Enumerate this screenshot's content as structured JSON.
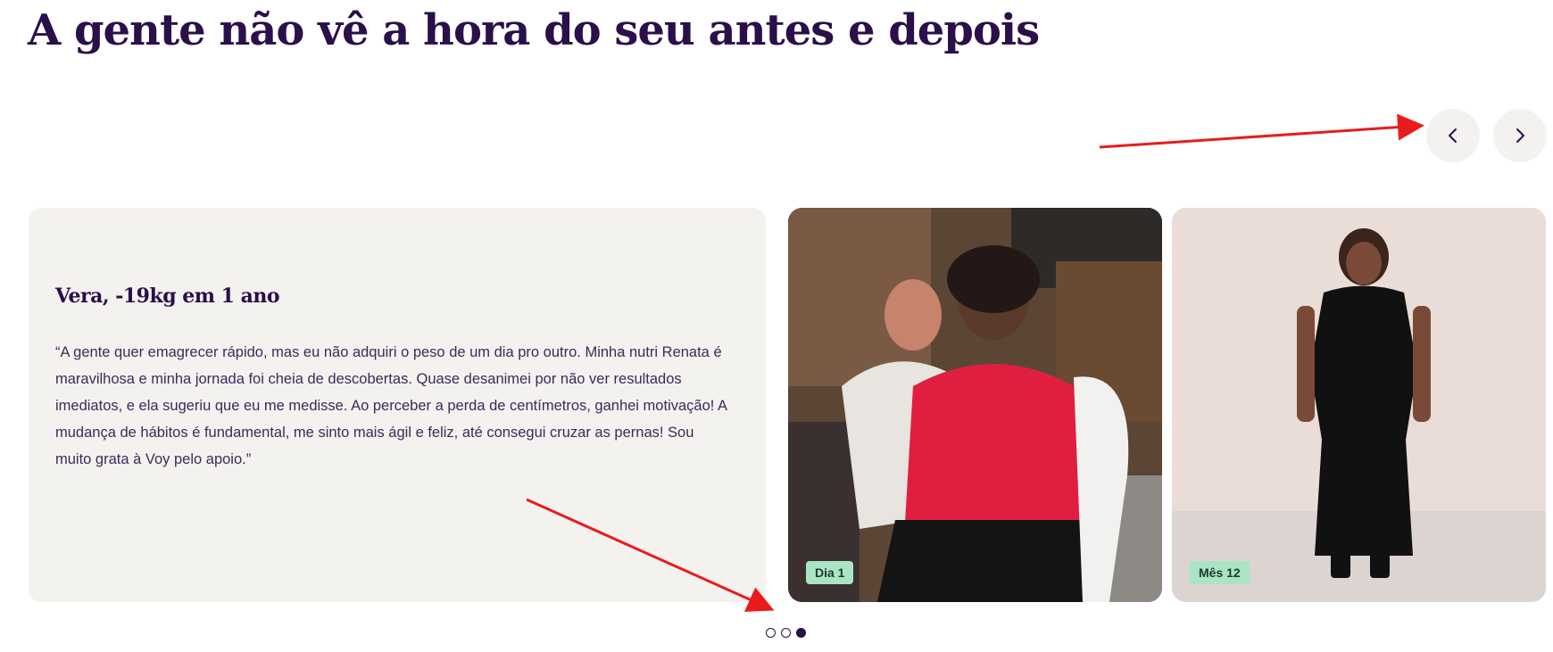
{
  "headline": "A gente não vê a hora do seu antes e depois",
  "nav": {
    "prev_icon": "chevron-left-icon",
    "next_icon": "chevron-right-icon"
  },
  "testimonial": {
    "title": "Vera, -19kg em 1 ano",
    "quote": "“A gente quer emagrecer rápido, mas eu não adquiri o peso de um dia pro outro. Minha nutri Renata é maravilhosa e minha jornada foi cheia de descobertas. Quase desanimei por não ver resultados imediatos, e ela sugeriu que eu me medisse. Ao perceber a perda de centímetros, ganhei motivação! A mudança de hábitos é fundamental, me sinto mais ágil e feliz, até consegui cruzar as pernas! Sou muito grata à Voy pelo apoio.”"
  },
  "photos": [
    {
      "badge": "Dia 1"
    },
    {
      "badge": "Mês 12"
    }
  ],
  "pagination": {
    "total": 3,
    "active": 3
  },
  "colors": {
    "primary": "#2a0f4a",
    "card_bg": "#f4f2ef",
    "badge_bg": "#a9e5c4",
    "annotation": "#e81c1c"
  }
}
